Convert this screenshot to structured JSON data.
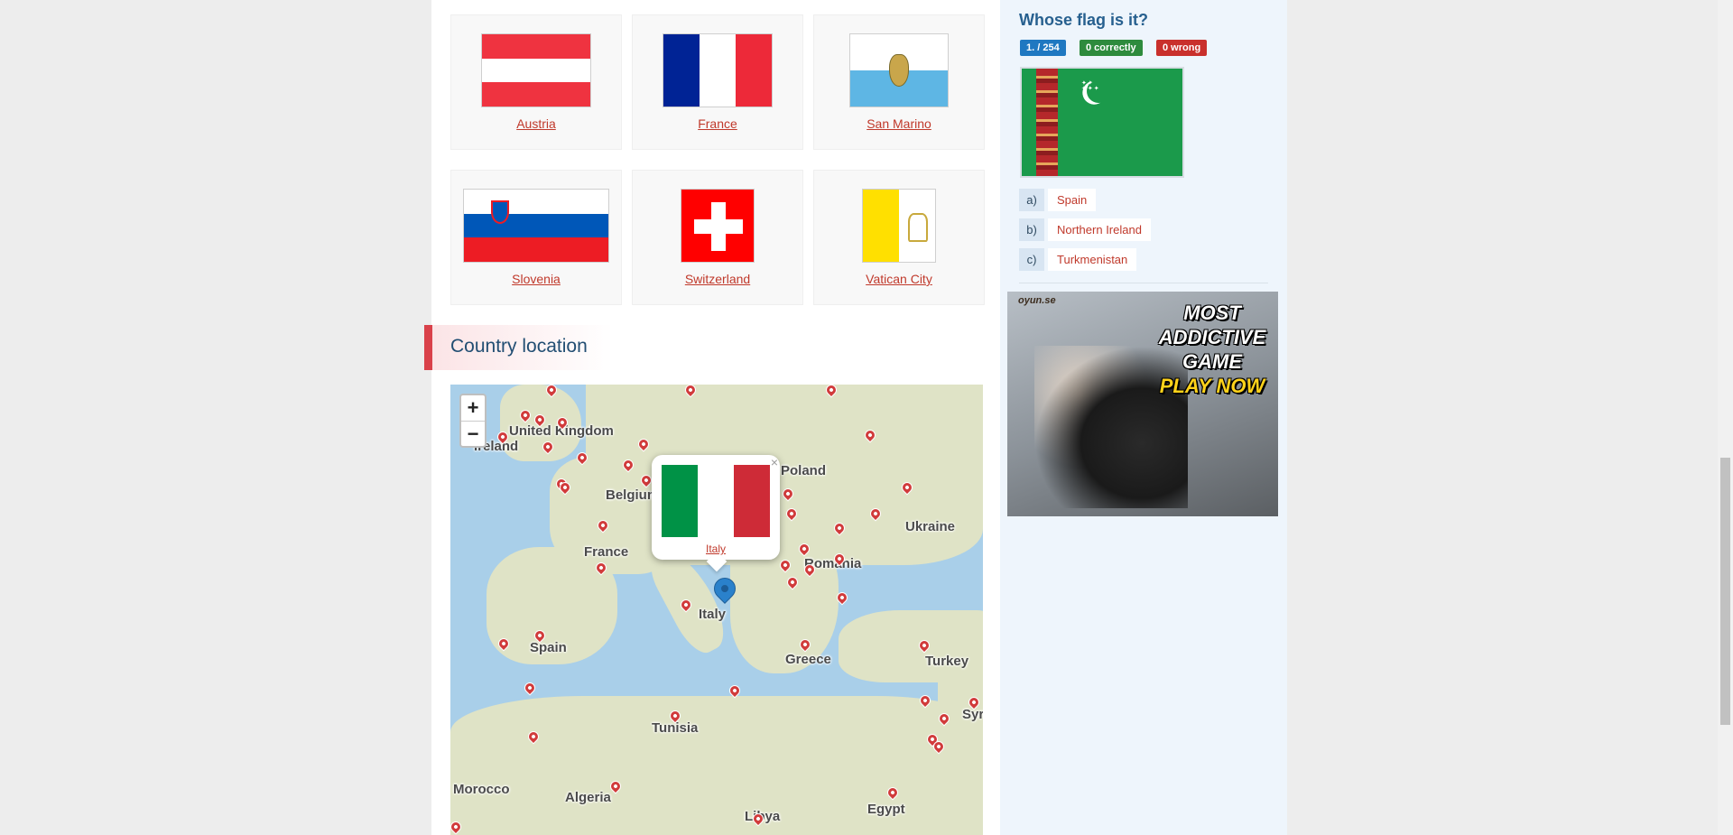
{
  "flags": [
    {
      "name": "Austria"
    },
    {
      "name": "France"
    },
    {
      "name": "San Marino"
    },
    {
      "name": "Slovenia"
    },
    {
      "name": "Switzerland"
    },
    {
      "name": "Vatican City"
    }
  ],
  "section": {
    "title": "Country location"
  },
  "map": {
    "zoom_in": "+",
    "zoom_out": "−",
    "labels": [
      "United Kingdom",
      "Ireland",
      "Belgium",
      "France",
      "Spain",
      "Italy",
      "Romania",
      "Ukraine",
      "Greece",
      "Turkey",
      "Tunisia",
      "Algeria",
      "Morocco",
      "Libya",
      "Egypt",
      "Syria",
      "Poland"
    ],
    "popup": {
      "country": "Italy",
      "close": "×"
    }
  },
  "quiz": {
    "title": "Whose flag is it?",
    "counter": "1. / 254",
    "correct": "0 correctly",
    "wrong": "0 wrong",
    "options": [
      {
        "letter": "a)",
        "text": "Spain"
      },
      {
        "letter": "b)",
        "text": "Northern Ireland"
      },
      {
        "letter": "c)",
        "text": "Turkmenistan"
      }
    ]
  },
  "ad": {
    "brand": "oyun.se",
    "line1": "MOST",
    "line2": "ADDICTIVE",
    "line3": "GAME",
    "cta": "PLAY NOW"
  },
  "colors": {
    "accent": "#d9414a",
    "link": "#c0392b",
    "heading": "#224e73",
    "badge_blue": "#1f78c1",
    "badge_green": "#2e8b3d",
    "badge_red": "#c9302c"
  }
}
